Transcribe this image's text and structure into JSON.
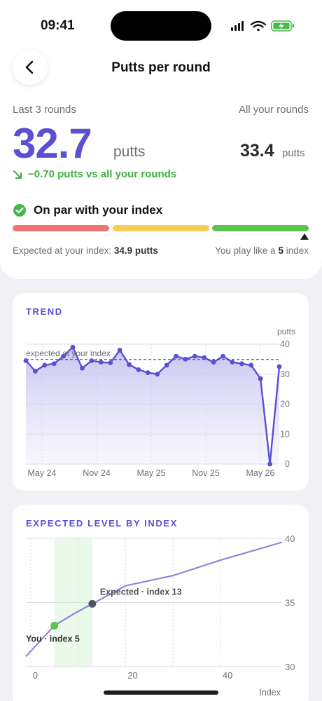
{
  "status": {
    "time": "09:41"
  },
  "header": {
    "title": "Putts per round"
  },
  "summary": {
    "last_label": "Last 3 rounds",
    "all_label": "All your rounds",
    "last_value": "32.7",
    "last_unit": "putts",
    "all_value": "33.4",
    "all_unit": "putts",
    "delta_text": "−0.70 putts vs all your rounds"
  },
  "par": {
    "status_text": "On par with your index",
    "expected_prefix": "Expected at your index:",
    "expected_value": "34.9 putts",
    "play_prefix": "You play like a",
    "play_value": "5",
    "play_suffix": "index",
    "level_fraction": 0.97
  },
  "colors": {
    "accent": "#5b4fd3",
    "good": "#3fae3f",
    "bad": "#f17272",
    "mid": "#f6cd55",
    "ok": "#5ec24e"
  },
  "trend": {
    "title": "TREND",
    "unit": "putts",
    "expected_label": "expected at your index",
    "chart_data": {
      "type": "line",
      "ylim": [
        0,
        40
      ],
      "y_ticks": [
        "40",
        "30",
        "20",
        "10",
        "0"
      ],
      "x_ticks": [
        "May 24",
        "Nov 24",
        "May 25",
        "Nov 25",
        "May 26"
      ],
      "expected": 34.9,
      "series": [
        {
          "values": [
            34.5,
            31,
            33,
            33.5,
            36,
            39,
            32,
            34.5,
            34,
            33.8,
            38,
            33.2,
            31.5,
            30.5,
            30,
            33,
            36,
            35,
            36,
            35.5,
            34,
            36,
            34,
            33.5,
            33,
            28.5,
            0,
            32.5
          ]
        }
      ]
    }
  },
  "index_chart": {
    "title": "EXPECTED LEVEL BY INDEX",
    "x_label": "Index",
    "you_label": "You · index 5",
    "expected_label": "Expected · index 13",
    "chart_data": {
      "type": "line",
      "xlim": [
        -1,
        53
      ],
      "ylim": [
        30,
        40
      ],
      "x_ticks": [
        "0",
        "20",
        "40"
      ],
      "y_ticks": [
        "40",
        "35",
        "30"
      ],
      "band": [
        5,
        13
      ],
      "series": [
        {
          "x": [
            -1,
            3,
            5,
            9,
            13,
            20,
            30,
            40,
            53
          ],
          "y": [
            30.8,
            32.4,
            33.2,
            34.1,
            34.9,
            36.3,
            37.1,
            38.3,
            39.7
          ]
        }
      ],
      "points": [
        {
          "x": 5,
          "y": 33.2
        },
        {
          "x": 13,
          "y": 34.9
        }
      ]
    }
  }
}
